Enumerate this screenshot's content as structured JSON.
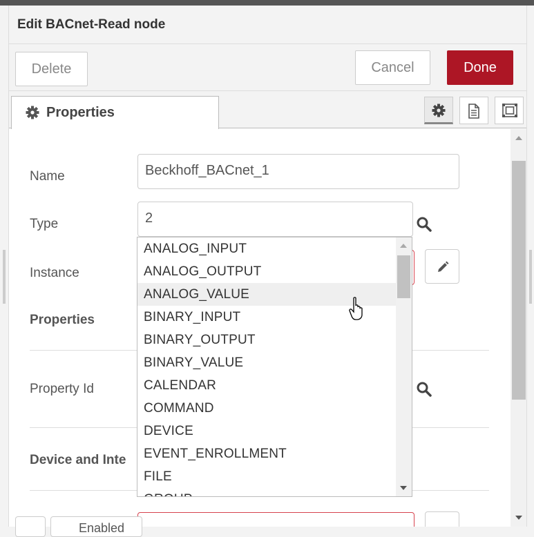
{
  "dialog": {
    "title": "Edit BACnet-Read node",
    "delete_label": "Delete",
    "cancel_label": "Cancel",
    "done_label": "Done",
    "accent_color": "#ad1625"
  },
  "tabs": {
    "properties_label": "Properties",
    "side_buttons": [
      "gear-icon",
      "description-icon",
      "appearance-icon"
    ]
  },
  "form": {
    "name_label": "Name",
    "name_value": "Beckhoff_BACnet_1",
    "type_label": "Type",
    "type_value": "2",
    "instance_label": "Instance",
    "properties_section": "Properties",
    "property_id_label": "Property Id",
    "device_section": "Device and Inte"
  },
  "dropdown": {
    "items": [
      "ANALOG_INPUT",
      "ANALOG_OUTPUT",
      "ANALOG_VALUE",
      "BINARY_INPUT",
      "BINARY_OUTPUT",
      "BINARY_VALUE",
      "CALENDAR",
      "COMMAND",
      "DEVICE",
      "EVENT_ENROLLMENT",
      "FILE",
      "GROUP"
    ],
    "hovered": "ANALOG_VALUE"
  },
  "footer": {
    "enabled_label": "Enabled"
  }
}
